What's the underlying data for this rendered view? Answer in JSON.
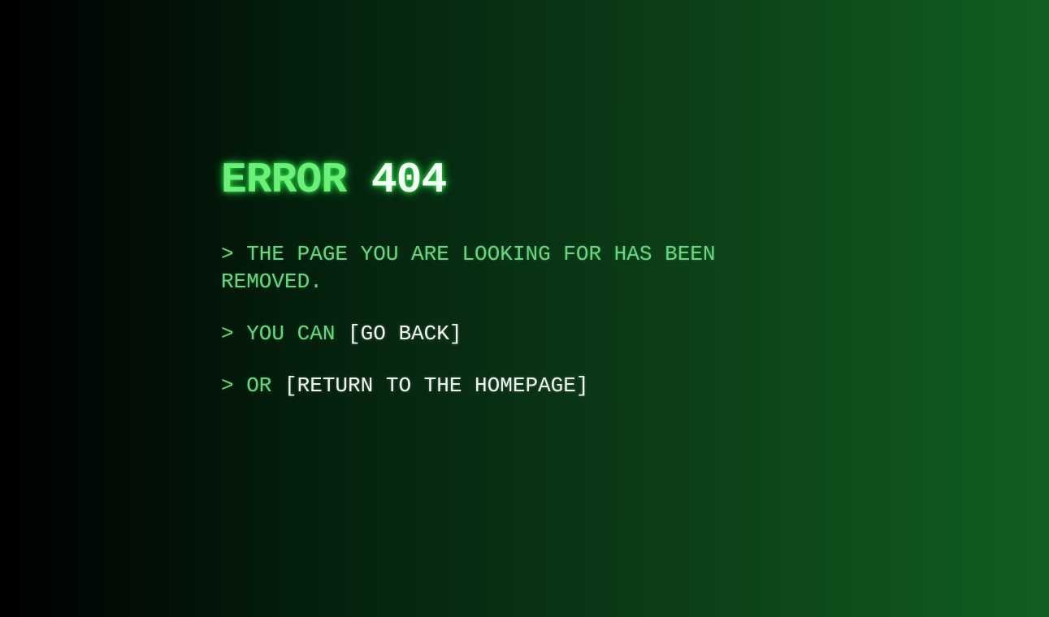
{
  "title": {
    "word": "ERROR",
    "code": "404"
  },
  "lines": {
    "removed": "> THE PAGE YOU ARE LOOKING FOR HAS BEEN REMOVED.",
    "you_can_prefix": "> YOU CAN ",
    "go_back_link": "[GO BACK]",
    "or_prefix": "> OR ",
    "homepage_link": "[RETURN TO THE HOMEPAGE]"
  },
  "colors": {
    "prompt_text": "#6ed483",
    "title_green": "#6cf07a",
    "link_text": "#f1f6f1",
    "bg_left": "#000000",
    "bg_right": "#125e22"
  }
}
